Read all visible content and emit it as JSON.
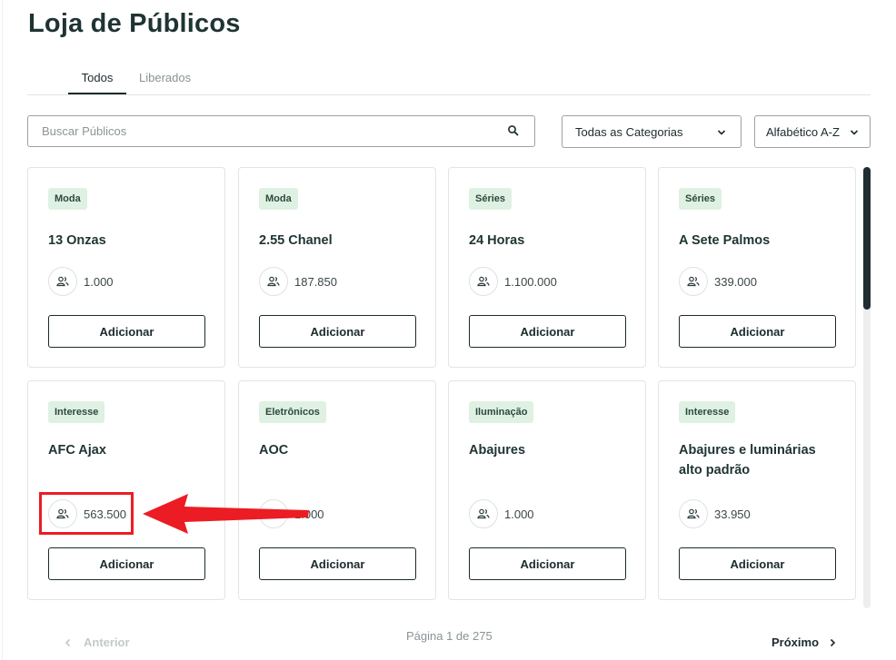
{
  "page": {
    "title": "Loja de Públicos"
  },
  "tabs": [
    {
      "label": "Todos",
      "active": true
    },
    {
      "label": "Liberados",
      "active": false
    }
  ],
  "search": {
    "placeholder": "Buscar Públicos",
    "value": "",
    "icon": "search-icon"
  },
  "filters": {
    "category": {
      "selected": "Todas as Categorias"
    },
    "sort": {
      "selected": "Alfabético A-Z"
    }
  },
  "cards": [
    {
      "category": "Moda",
      "title": "13 Onzas",
      "audience": "1.000",
      "button": "Adicionar"
    },
    {
      "category": "Moda",
      "title": "2.55 Chanel",
      "audience": "187.850",
      "button": "Adicionar"
    },
    {
      "category": "Séries",
      "title": "24 Horas",
      "audience": "1.100.000",
      "button": "Adicionar"
    },
    {
      "category": "Séries",
      "title": "A Sete Palmos",
      "audience": "339.000",
      "button": "Adicionar"
    },
    {
      "category": "Interesse",
      "title": "AFC Ajax",
      "audience": "563.500",
      "button": "Adicionar"
    },
    {
      "category": "Eletrônicos",
      "title": "AOC",
      "audience": "1.000",
      "button": "Adicionar"
    },
    {
      "category": "Iluminação",
      "title": "Abajures",
      "audience": "1.000",
      "button": "Adicionar"
    },
    {
      "category": "Interesse",
      "title": "Abajures e luminárias alto padrão",
      "audience": "33.950",
      "button": "Adicionar"
    }
  ],
  "pagination": {
    "prev_label": "Anterior",
    "info": "Página 1 de 275",
    "next_label": "Próximo"
  },
  "colors": {
    "badge_bg": "#dff1e2",
    "annotation_red": "#ec1c24",
    "text_dark": "#1e3433"
  }
}
